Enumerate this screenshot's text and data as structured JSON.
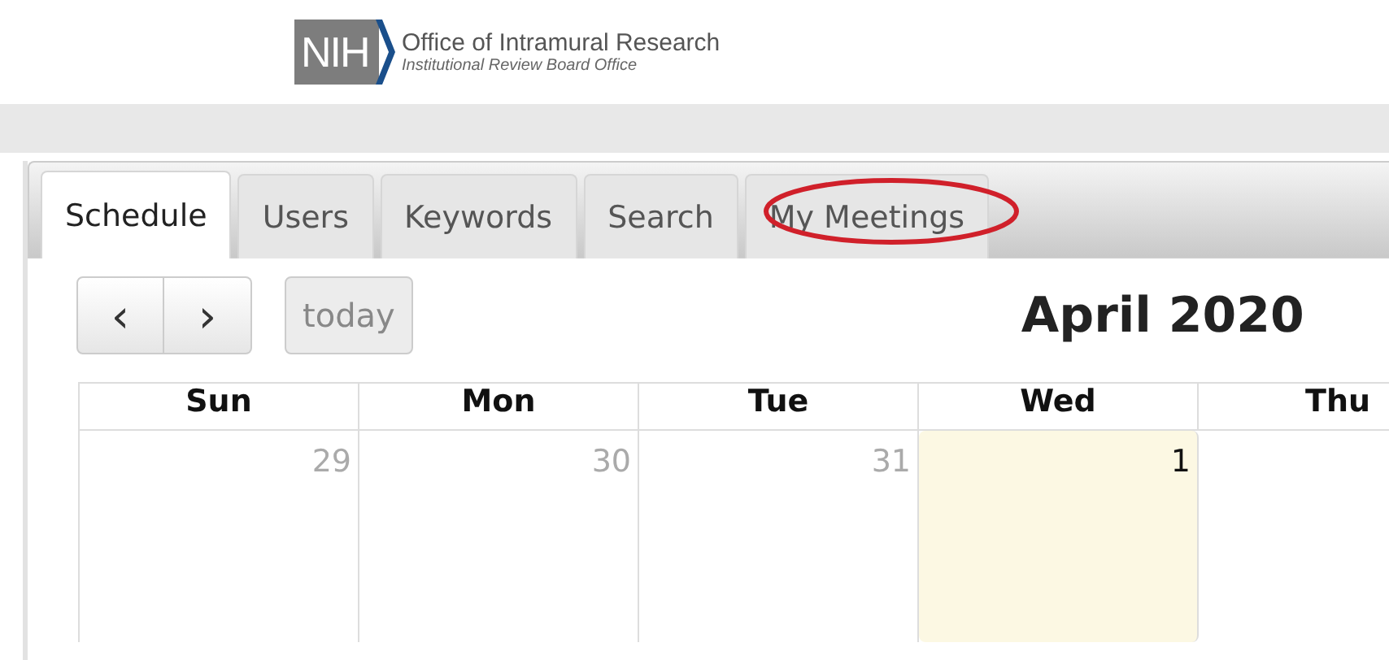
{
  "header": {
    "logo_mark": "NIH",
    "title": "Office of Intramural Research",
    "subtitle": "Institutional Review Board Office"
  },
  "tabs": [
    {
      "label": "Schedule",
      "selected": true,
      "circled": false
    },
    {
      "label": "Users",
      "selected": false,
      "circled": false
    },
    {
      "label": "Keywords",
      "selected": false,
      "circled": false
    },
    {
      "label": "Search",
      "selected": false,
      "circled": false
    },
    {
      "label": "My Meetings",
      "selected": false,
      "circled": true
    }
  ],
  "toolbar": {
    "prev": "‹",
    "next": "›",
    "today": "today",
    "title": "April 2020"
  },
  "calendar": {
    "weekdays": [
      "Sun",
      "Mon",
      "Tue",
      "Wed",
      "Thu"
    ],
    "days": [
      {
        "number": "29",
        "other_month": true,
        "today": false
      },
      {
        "number": "30",
        "other_month": true,
        "today": false
      },
      {
        "number": "31",
        "other_month": true,
        "today": false
      },
      {
        "number": "1",
        "other_month": false,
        "today": true
      }
    ]
  }
}
